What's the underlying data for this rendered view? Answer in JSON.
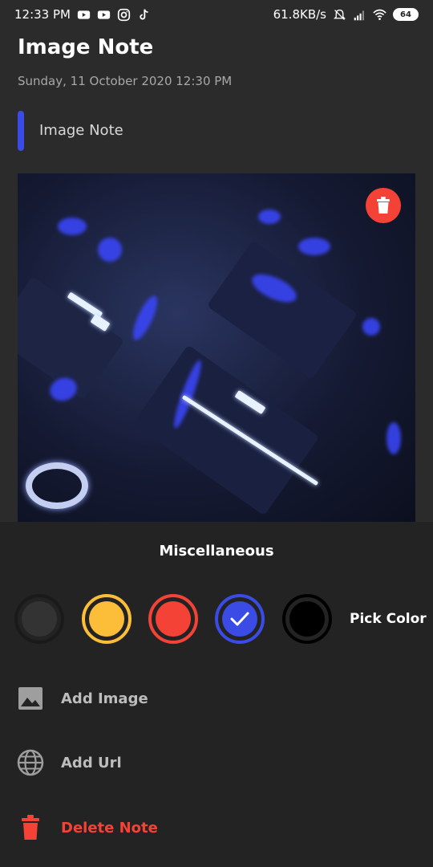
{
  "status_bar": {
    "time": "12:33 PM",
    "left_icons": [
      "youtube-icon",
      "youtube-icon",
      "instagram-icon",
      "tiktok-icon"
    ],
    "network_speed": "61.8KB/s",
    "right_icons": [
      "mute-icon",
      "signal-icon",
      "wifi-icon"
    ],
    "battery": "64"
  },
  "note": {
    "title": "Image Note",
    "datetime": "Sunday, 11 October 2020 12:30 PM",
    "subtitle": "Image Note",
    "accent_color": "#3a4be6"
  },
  "image": {
    "delete_icon": "trash-icon",
    "delete_color": "#f44336"
  },
  "miscellaneous": {
    "title": "Miscellaneous",
    "colors": [
      {
        "name": "gray",
        "fill": "#333333",
        "ring": "#1a1a1a",
        "selected": false
      },
      {
        "name": "yellow",
        "fill": "#fcbd38",
        "ring": "#fcbd38",
        "selected": false
      },
      {
        "name": "red",
        "fill": "#f44336",
        "ring": "#f44336",
        "selected": false
      },
      {
        "name": "blue",
        "fill": "#3a4be6",
        "ring": "#3a4be6",
        "selected": true
      },
      {
        "name": "black",
        "fill": "#000000",
        "ring": "#000000",
        "selected": false
      }
    ],
    "pick_color_label": "Pick Color",
    "actions": [
      {
        "label": "Add Image",
        "icon": "image-icon"
      },
      {
        "label": "Add Url",
        "icon": "globe-icon"
      },
      {
        "label": "Delete Note",
        "icon": "trash-icon"
      }
    ]
  }
}
